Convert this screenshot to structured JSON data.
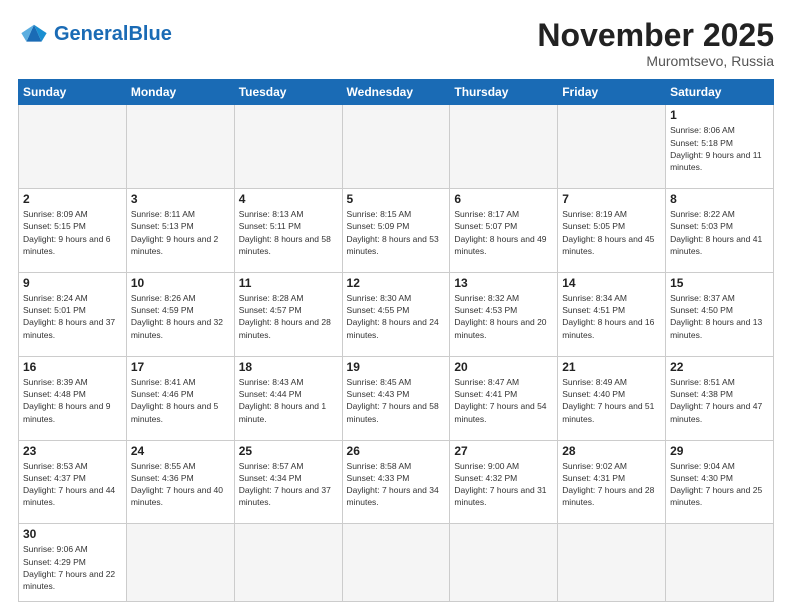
{
  "header": {
    "logo_general": "General",
    "logo_blue": "Blue",
    "month_title": "November 2025",
    "location": "Muromtsevo, Russia"
  },
  "weekdays": [
    "Sunday",
    "Monday",
    "Tuesday",
    "Wednesday",
    "Thursday",
    "Friday",
    "Saturday"
  ],
  "days": {
    "1": {
      "sunrise": "8:06 AM",
      "sunset": "5:18 PM",
      "daylight": "9 hours and 11 minutes."
    },
    "2": {
      "sunrise": "8:09 AM",
      "sunset": "5:15 PM",
      "daylight": "9 hours and 6 minutes."
    },
    "3": {
      "sunrise": "8:11 AM",
      "sunset": "5:13 PM",
      "daylight": "9 hours and 2 minutes."
    },
    "4": {
      "sunrise": "8:13 AM",
      "sunset": "5:11 PM",
      "daylight": "8 hours and 58 minutes."
    },
    "5": {
      "sunrise": "8:15 AM",
      "sunset": "5:09 PM",
      "daylight": "8 hours and 53 minutes."
    },
    "6": {
      "sunrise": "8:17 AM",
      "sunset": "5:07 PM",
      "daylight": "8 hours and 49 minutes."
    },
    "7": {
      "sunrise": "8:19 AM",
      "sunset": "5:05 PM",
      "daylight": "8 hours and 45 minutes."
    },
    "8": {
      "sunrise": "8:22 AM",
      "sunset": "5:03 PM",
      "daylight": "8 hours and 41 minutes."
    },
    "9": {
      "sunrise": "8:24 AM",
      "sunset": "5:01 PM",
      "daylight": "8 hours and 37 minutes."
    },
    "10": {
      "sunrise": "8:26 AM",
      "sunset": "4:59 PM",
      "daylight": "8 hours and 32 minutes."
    },
    "11": {
      "sunrise": "8:28 AM",
      "sunset": "4:57 PM",
      "daylight": "8 hours and 28 minutes."
    },
    "12": {
      "sunrise": "8:30 AM",
      "sunset": "4:55 PM",
      "daylight": "8 hours and 24 minutes."
    },
    "13": {
      "sunrise": "8:32 AM",
      "sunset": "4:53 PM",
      "daylight": "8 hours and 20 minutes."
    },
    "14": {
      "sunrise": "8:34 AM",
      "sunset": "4:51 PM",
      "daylight": "8 hours and 16 minutes."
    },
    "15": {
      "sunrise": "8:37 AM",
      "sunset": "4:50 PM",
      "daylight": "8 hours and 13 minutes."
    },
    "16": {
      "sunrise": "8:39 AM",
      "sunset": "4:48 PM",
      "daylight": "8 hours and 9 minutes."
    },
    "17": {
      "sunrise": "8:41 AM",
      "sunset": "4:46 PM",
      "daylight": "8 hours and 5 minutes."
    },
    "18": {
      "sunrise": "8:43 AM",
      "sunset": "4:44 PM",
      "daylight": "8 hours and 1 minute."
    },
    "19": {
      "sunrise": "8:45 AM",
      "sunset": "4:43 PM",
      "daylight": "7 hours and 58 minutes."
    },
    "20": {
      "sunrise": "8:47 AM",
      "sunset": "4:41 PM",
      "daylight": "7 hours and 54 minutes."
    },
    "21": {
      "sunrise": "8:49 AM",
      "sunset": "4:40 PM",
      "daylight": "7 hours and 51 minutes."
    },
    "22": {
      "sunrise": "8:51 AM",
      "sunset": "4:38 PM",
      "daylight": "7 hours and 47 minutes."
    },
    "23": {
      "sunrise": "8:53 AM",
      "sunset": "4:37 PM",
      "daylight": "7 hours and 44 minutes."
    },
    "24": {
      "sunrise": "8:55 AM",
      "sunset": "4:36 PM",
      "daylight": "7 hours and 40 minutes."
    },
    "25": {
      "sunrise": "8:57 AM",
      "sunset": "4:34 PM",
      "daylight": "7 hours and 37 minutes."
    },
    "26": {
      "sunrise": "8:58 AM",
      "sunset": "4:33 PM",
      "daylight": "7 hours and 34 minutes."
    },
    "27": {
      "sunrise": "9:00 AM",
      "sunset": "4:32 PM",
      "daylight": "7 hours and 31 minutes."
    },
    "28": {
      "sunrise": "9:02 AM",
      "sunset": "4:31 PM",
      "daylight": "7 hours and 28 minutes."
    },
    "29": {
      "sunrise": "9:04 AM",
      "sunset": "4:30 PM",
      "daylight": "7 hours and 25 minutes."
    },
    "30": {
      "sunrise": "9:06 AM",
      "sunset": "4:29 PM",
      "daylight": "7 hours and 22 minutes."
    }
  }
}
